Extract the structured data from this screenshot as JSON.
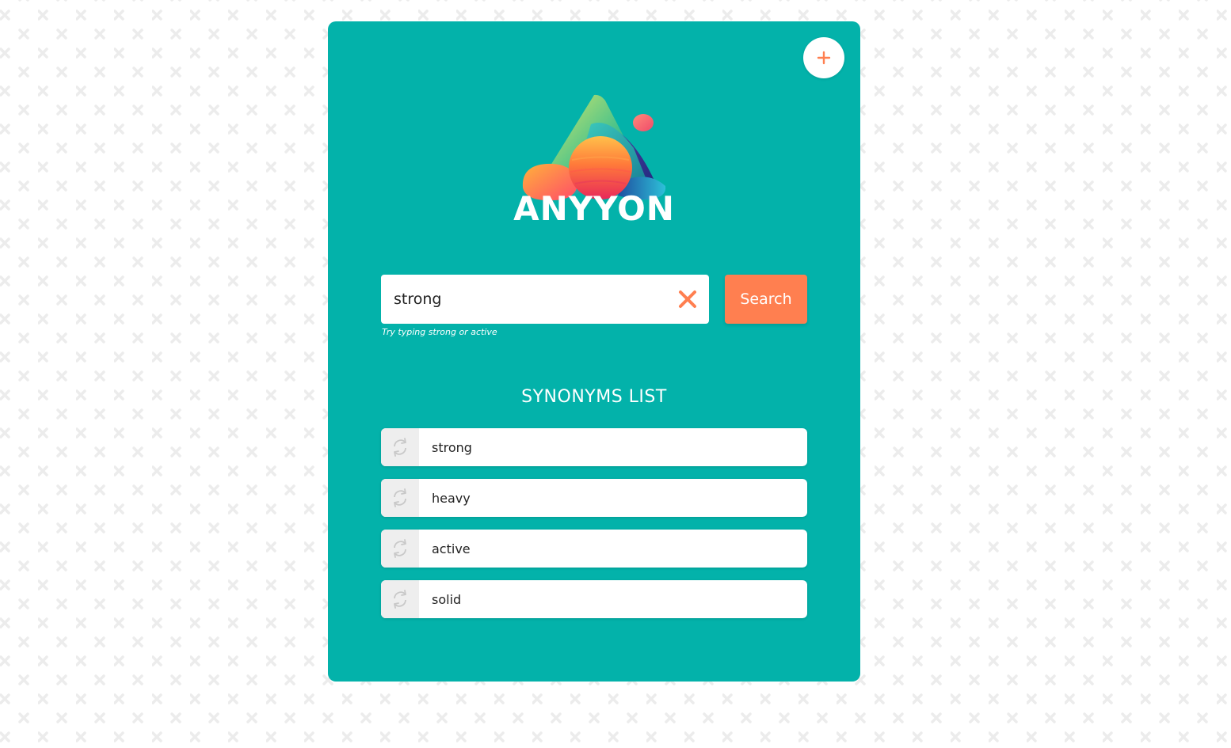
{
  "app": {
    "brand": "ANYYON"
  },
  "header": {
    "add_button_icon": "plus-icon"
  },
  "search": {
    "value": "strong",
    "clear_icon": "close-icon",
    "button_label": "Search",
    "hint": "Try typing strong or active"
  },
  "synonyms": {
    "title": "SYNONYMS LIST",
    "item_icon": "swap-icon",
    "items": [
      {
        "label": "strong"
      },
      {
        "label": "heavy"
      },
      {
        "label": "active"
      },
      {
        "label": "solid"
      }
    ]
  },
  "colors": {
    "card_background": "#03b2aa",
    "accent": "#ff7f50",
    "pattern": "#ececec"
  }
}
